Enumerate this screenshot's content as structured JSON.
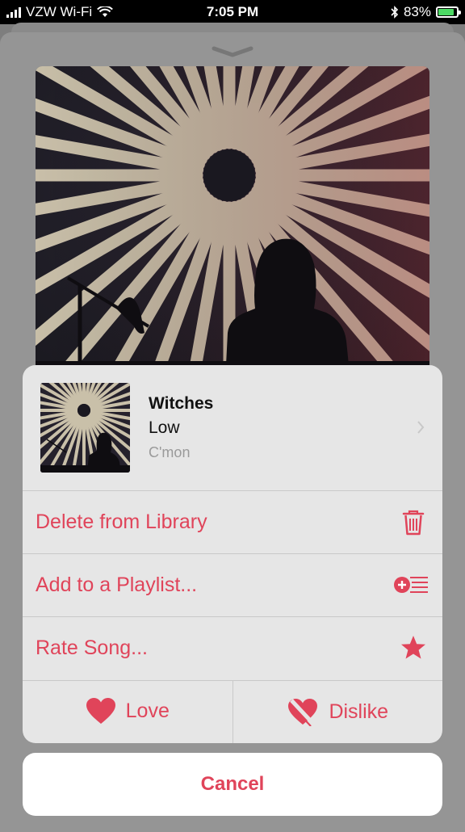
{
  "status_bar": {
    "carrier": "VZW Wi-Fi",
    "time": "7:05 PM",
    "battery": "83%",
    "battery_level": 0.83
  },
  "now_playing": {
    "artwork": "concert-light-burst"
  },
  "action_sheet": {
    "song": {
      "title": "Witches",
      "artist": "Low",
      "album": "C'mon"
    },
    "actions": [
      {
        "label": "Delete from Library",
        "icon": "trash-icon"
      },
      {
        "label": "Add to a Playlist...",
        "icon": "add-to-playlist-icon"
      },
      {
        "label": "Rate Song...",
        "icon": "star-icon"
      }
    ],
    "love_label": "Love",
    "dislike_label": "Dislike",
    "cancel_label": "Cancel"
  },
  "colors": {
    "accent": "#e0445a",
    "sheet_bg": "#e6e6e6",
    "status_bg": "#000000"
  }
}
